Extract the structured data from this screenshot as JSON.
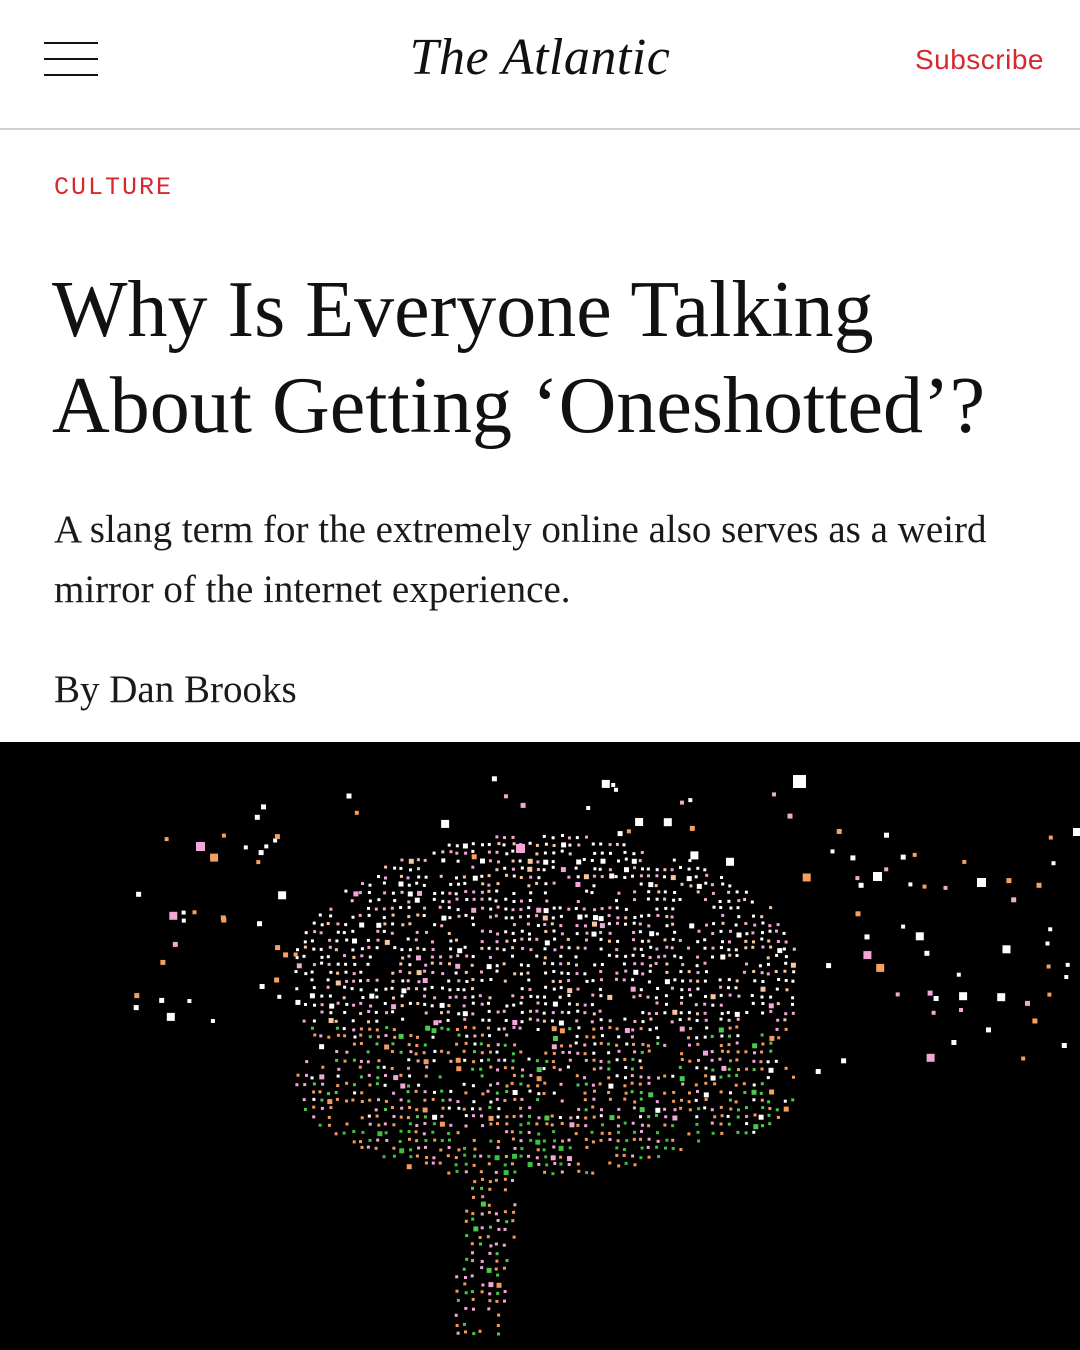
{
  "header": {
    "logo": "The Atlantic",
    "subscribe_label": "Subscribe"
  },
  "article": {
    "section": "CULTURE",
    "headline": "Why Is Everyone Talking About Getting ‘Oneshotted’?",
    "dek": "A slang term for the extremely online also serves as a weird mirror of the internet experience.",
    "byline_prefix": "By",
    "author": "Dan Brooks"
  },
  "colors": {
    "brand_red": "#d6282f",
    "hero_background": "#000000"
  },
  "icons": {
    "menu": "hamburger-menu-icon"
  }
}
